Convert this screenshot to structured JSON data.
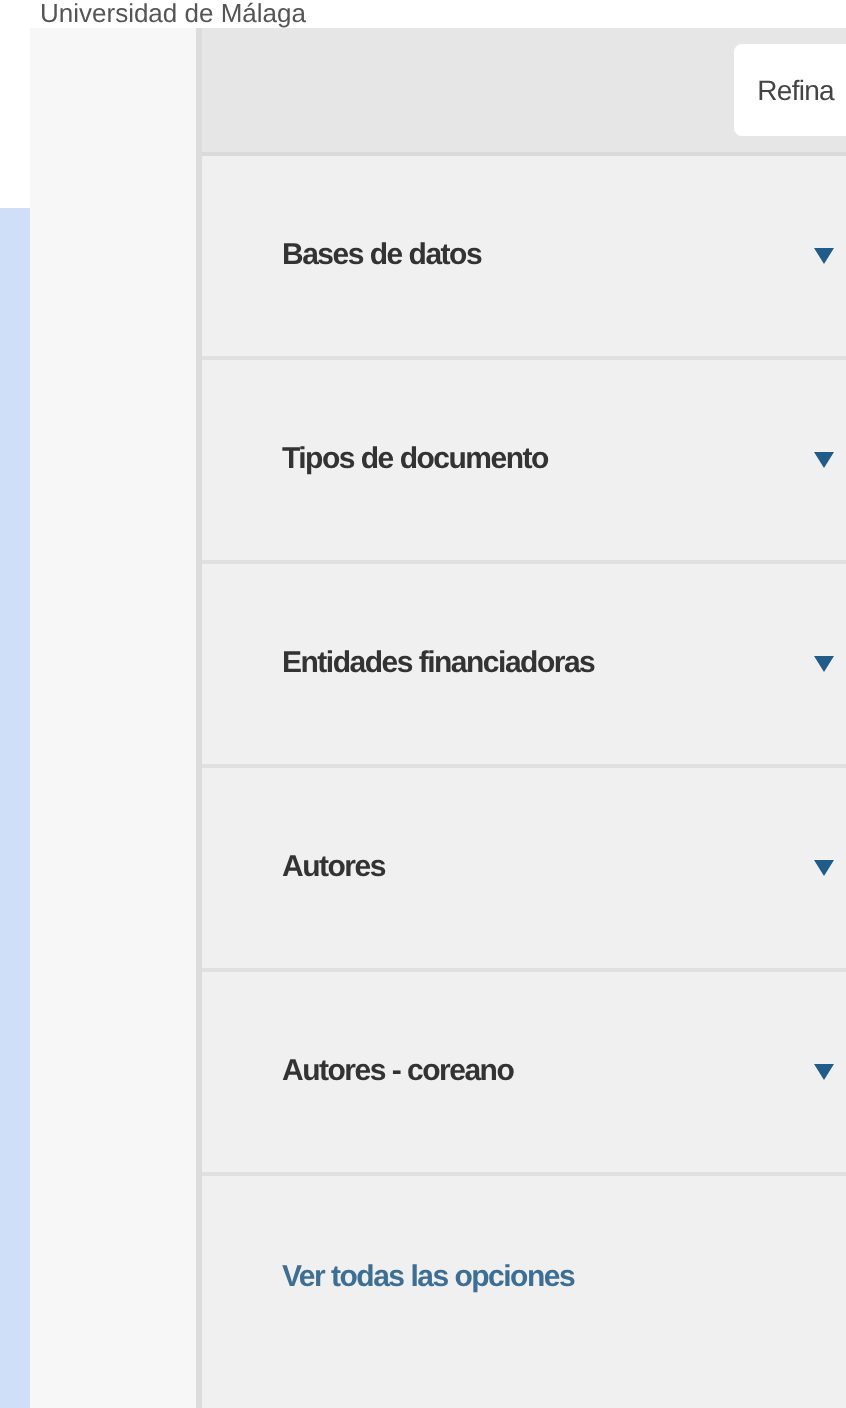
{
  "header": {
    "institution": "Universidad de Málaga"
  },
  "refine_button": {
    "label": "Refina"
  },
  "facets": [
    {
      "label": "Bases de datos",
      "expanded": false
    },
    {
      "label": "Tipos de documento",
      "expanded": false
    },
    {
      "label": "Entidades financiadoras",
      "expanded": false
    },
    {
      "label": "Autores",
      "expanded": false
    },
    {
      "label": "Autores - coreano",
      "expanded": false
    }
  ],
  "more_link": {
    "label": "Ver todas las opciones"
  }
}
